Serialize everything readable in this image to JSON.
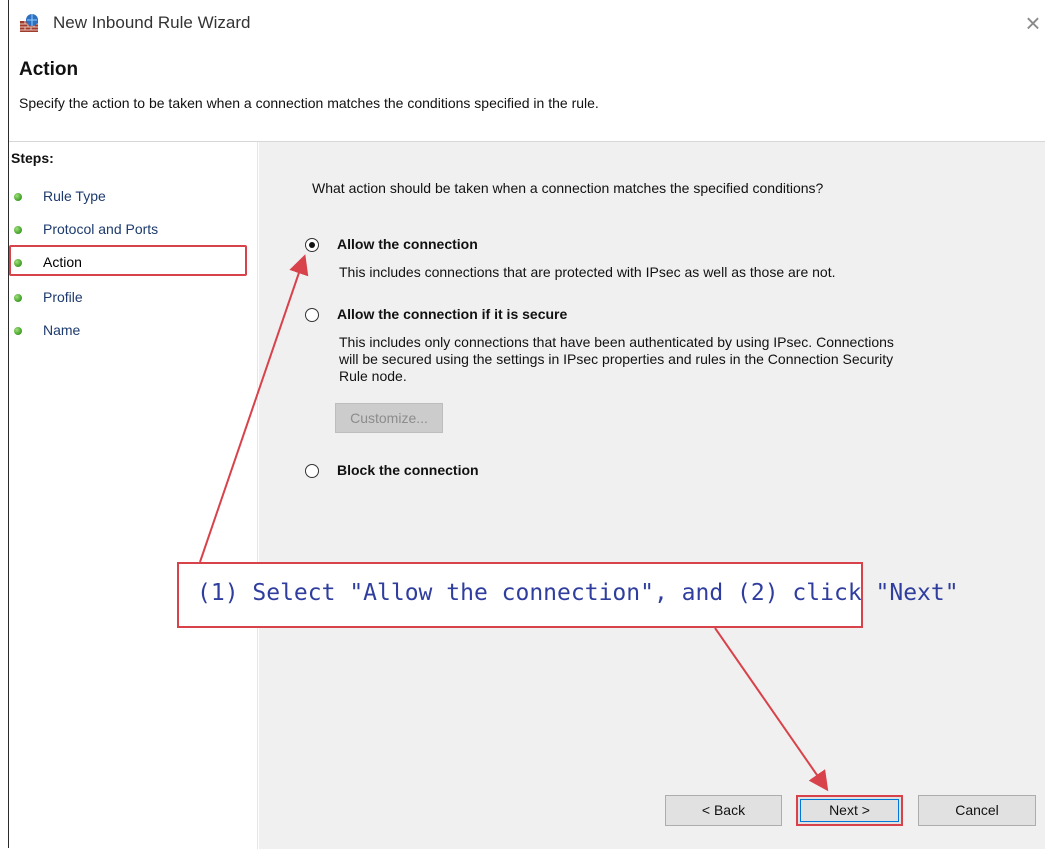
{
  "window": {
    "title": "New Inbound Rule Wizard",
    "close_glyph": "×",
    "app_icon": "firewall-icon"
  },
  "header": {
    "title": "Action",
    "subtitle": "Specify the action to be taken when a connection matches the conditions specified in the rule."
  },
  "steps": {
    "title": "Steps:",
    "current": "Action",
    "items": [
      {
        "label": "Rule Type"
      },
      {
        "label": "Protocol and Ports"
      },
      {
        "label": "Action"
      },
      {
        "label": "Profile"
      },
      {
        "label": "Name"
      }
    ]
  },
  "main": {
    "question": "What action should be taken when a connection matches the specified conditions?",
    "options": [
      {
        "label": "Allow the connection",
        "selected": true,
        "description": "This includes connections that are protected with IPsec as well as those are not."
      },
      {
        "label": "Allow the connection if it is secure",
        "selected": false,
        "description_lines": [
          "This includes only connections that have been authenticated by using IPsec.  Connections",
          "will be secured using the settings in IPsec properties and rules in the Connection Security",
          "Rule node."
        ]
      },
      {
        "label": "Block the connection",
        "selected": false
      }
    ],
    "customize_label": "Customize..."
  },
  "annotation": {
    "text": "(1) Select \"Allow the connection\", and (2) click \"Next\"",
    "color": "#d8424b"
  },
  "buttons": {
    "back": "< Back",
    "next": "Next >",
    "cancel": "Cancel"
  }
}
